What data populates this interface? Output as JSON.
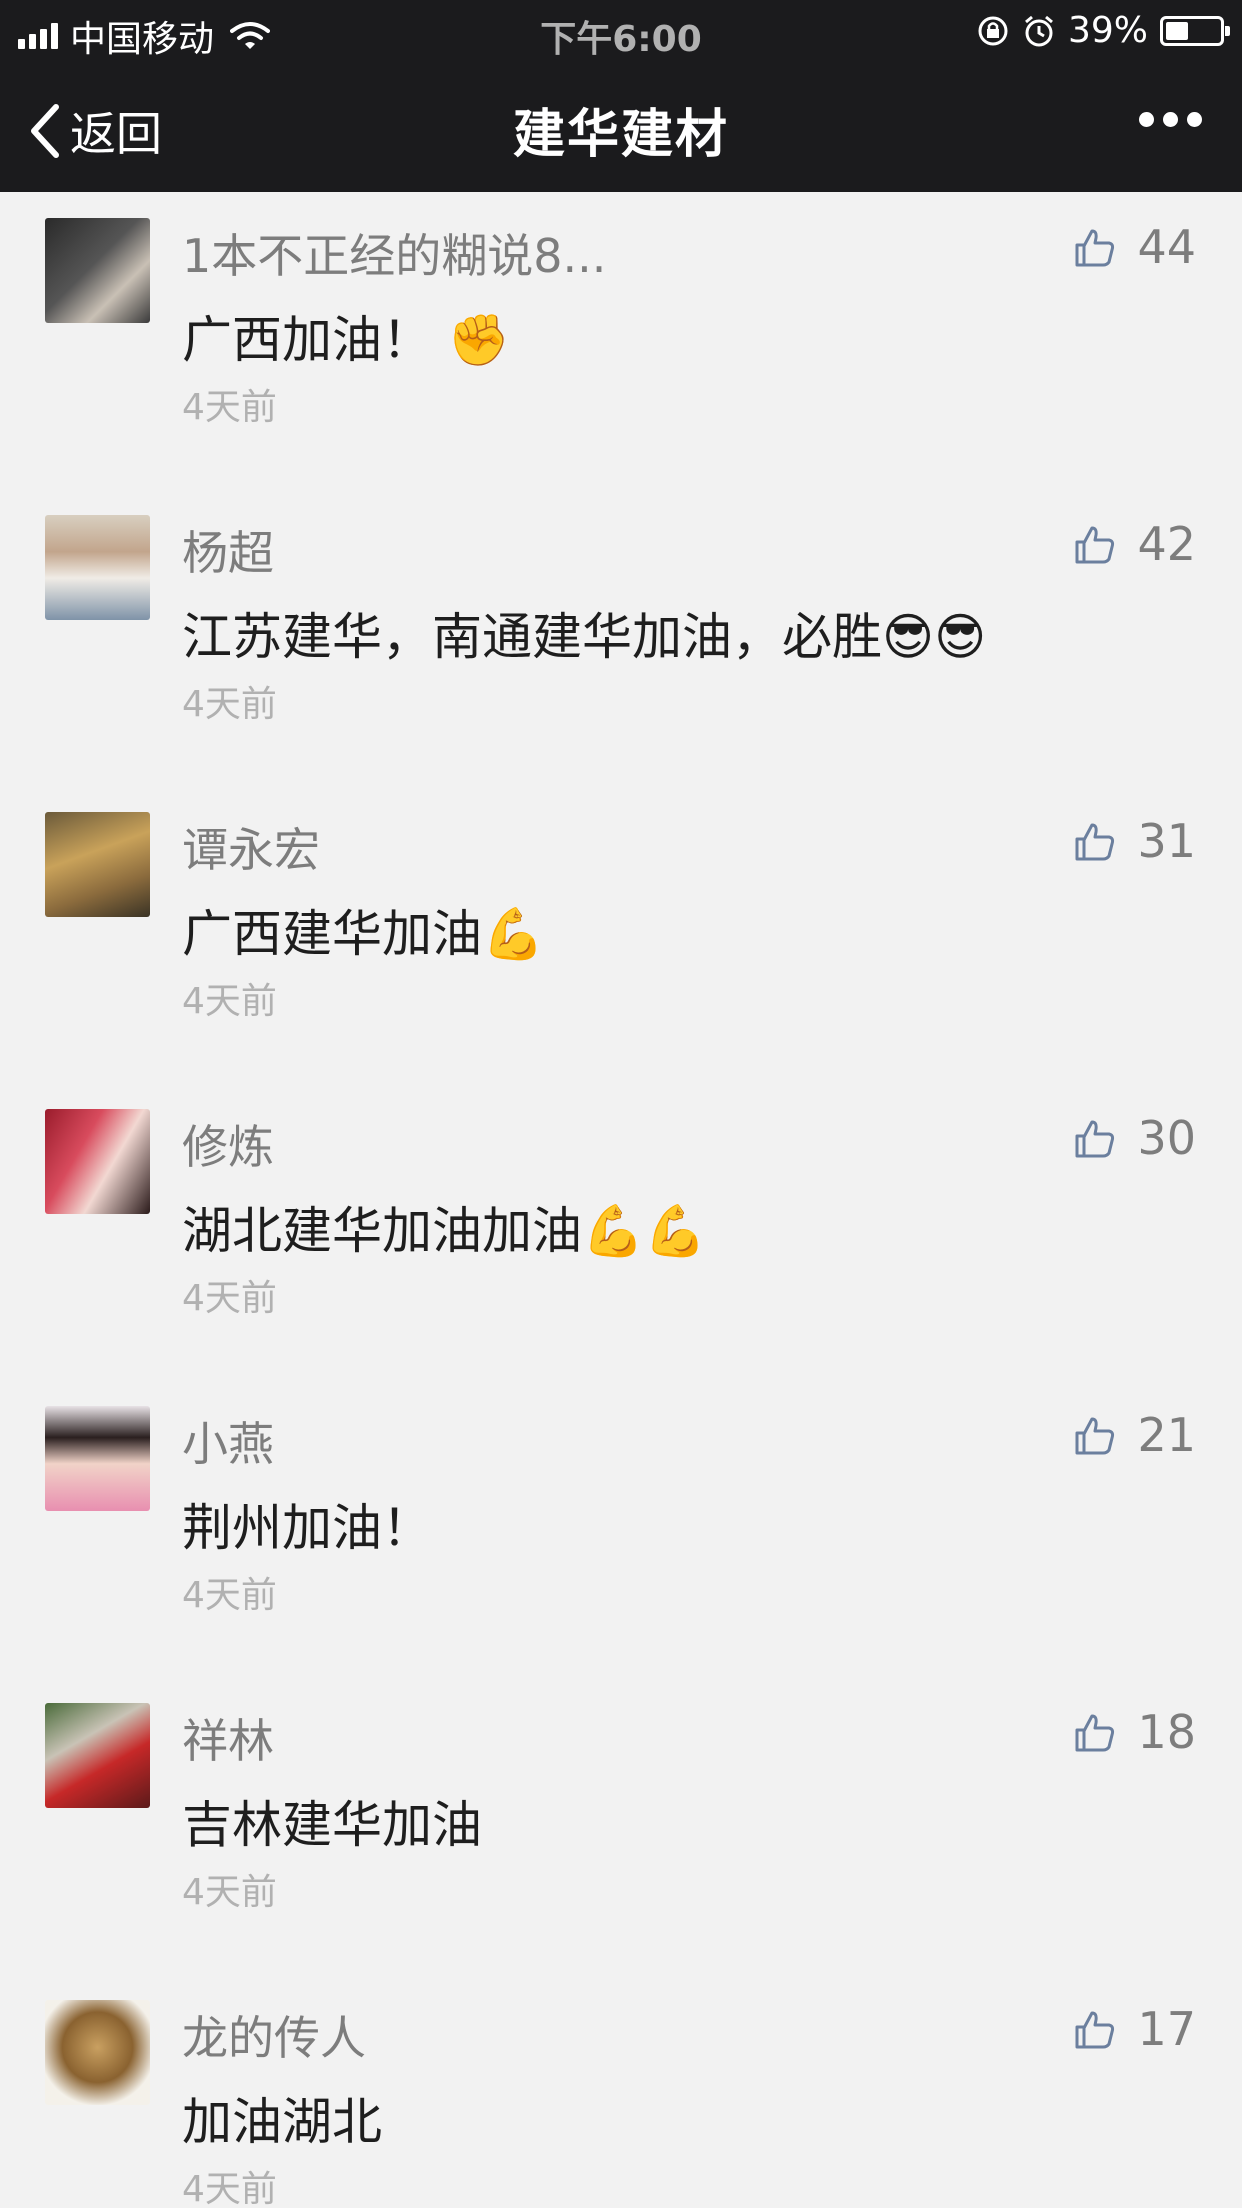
{
  "status_bar": {
    "carrier": "中国移动",
    "time": "下午6:00",
    "battery": "39%"
  },
  "nav": {
    "back_label": "返回",
    "title": "建华建材"
  },
  "comments": [
    {
      "name": "1本不正经的糊说8...",
      "content": "广西加油！ ✊",
      "time": "4天前",
      "likes": "44"
    },
    {
      "name": "杨超",
      "content": "江苏建华，南通建华加油，必胜😎😎",
      "time": "4天前",
      "likes": "42"
    },
    {
      "name": "谭永宏",
      "content": "广西建华加油💪",
      "time": "4天前",
      "likes": "31"
    },
    {
      "name": "修炼",
      "content": "湖北建华加油加油💪💪",
      "time": "4天前",
      "likes": "30"
    },
    {
      "name": "小燕",
      "content": "荆州加油！",
      "time": "4天前",
      "likes": "21"
    },
    {
      "name": "祥林",
      "content": "吉林建华加油",
      "time": "4天前",
      "likes": "18"
    },
    {
      "name": "龙的传人",
      "content": "加油湖北",
      "time": "4天前",
      "likes": "17"
    }
  ]
}
